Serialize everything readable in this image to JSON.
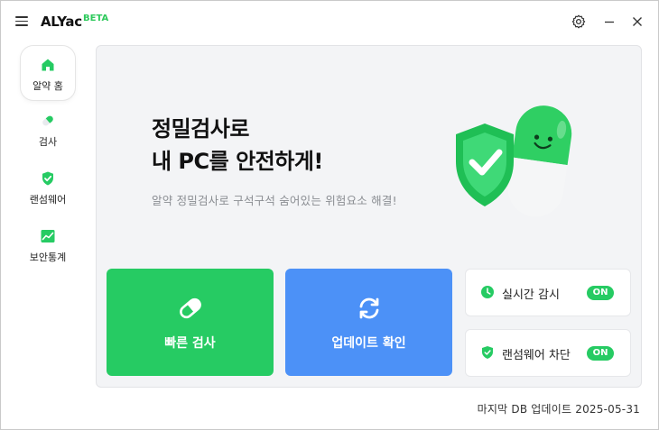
{
  "titlebar": {
    "app_name": "ALYac",
    "badge": "BETA",
    "icons": [
      "menu-icon",
      "gear-icon",
      "minimize-icon",
      "close-icon"
    ]
  },
  "sidebar": {
    "items": [
      {
        "label": "알약 홈",
        "icon": "home-icon",
        "active": true
      },
      {
        "label": "검사",
        "icon": "pill-icon",
        "active": false
      },
      {
        "label": "랜섬웨어",
        "icon": "shield-check-icon",
        "active": false
      },
      {
        "label": "보안통계",
        "icon": "chart-icon",
        "active": false
      }
    ]
  },
  "main": {
    "headline_line1": "정밀검사로",
    "headline_line2": "내 PC를 안전하게!",
    "subtext": "알약 정밀검사로 구석구석 숨어있는 위험요소 해결!",
    "quick_scan_label": "빠른 검사",
    "update_label": "업데이트 확인",
    "realtime_label": "실시간 감시",
    "realtime_state": "ON",
    "ransomware_label": "랜섬웨어 차단",
    "ransomware_state": "ON"
  },
  "footer": {
    "last_update": "마지막 DB 업데이트  2025-05-31"
  },
  "colors": {
    "brand_green": "#26cb63",
    "update_blue": "#4c91f7",
    "panel_bg": "#f3f4f6"
  }
}
